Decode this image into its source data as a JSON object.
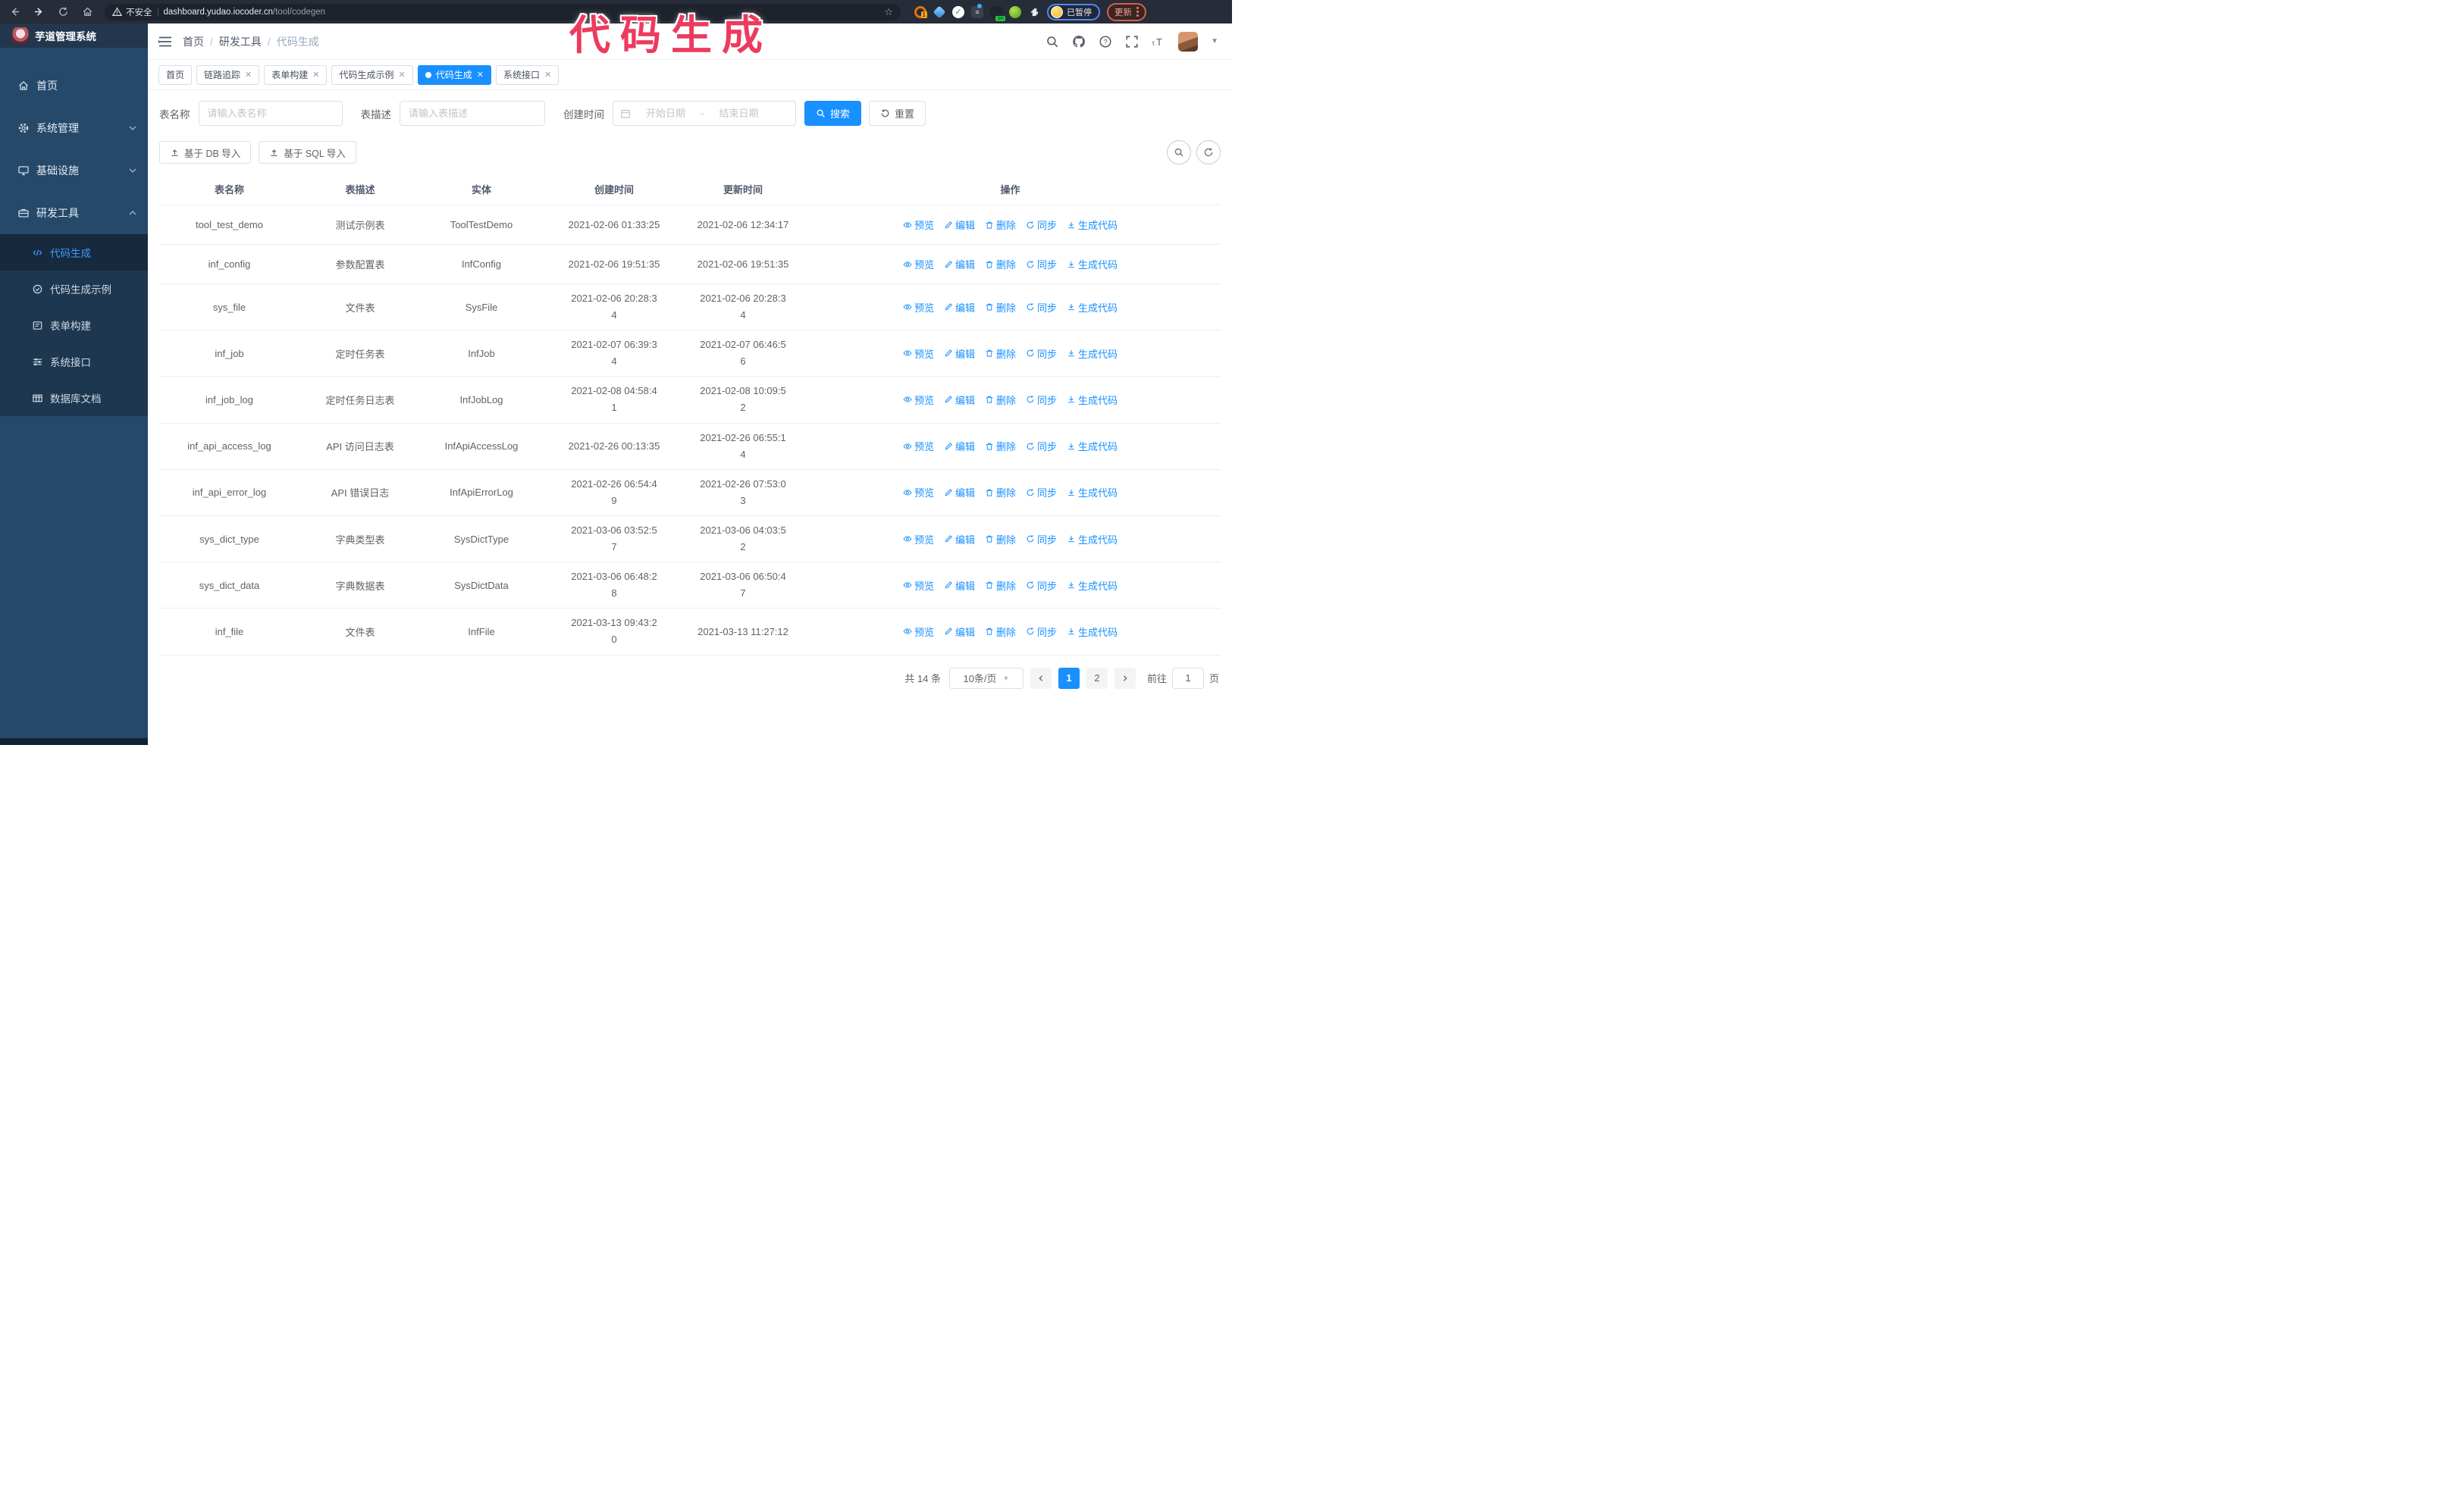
{
  "colors": {
    "accent": "#1890ff",
    "annotation": "#ed3a5f",
    "sidebar_bg": "#26496a",
    "submenu_bg": "#1d3750"
  },
  "annotation": {
    "text": "代码生成"
  },
  "browser": {
    "security_label": "不安全",
    "url_host": "dashboard.yudao.iocoder.cn",
    "url_path": "/tool/codegen",
    "ext_badge": "1",
    "ext_on_badge": "on",
    "paused_label": "已暂停",
    "update_label": "更新"
  },
  "sidebar": {
    "title": "芋道管理系统",
    "menu": [
      {
        "label": "首页",
        "icon": "home-icon"
      },
      {
        "label": "系统管理",
        "icon": "gear-icon",
        "chevron": "down"
      },
      {
        "label": "基础设施",
        "icon": "infrastructure-icon",
        "chevron": "down"
      },
      {
        "label": "研发工具",
        "icon": "tools-icon",
        "chevron": "up"
      }
    ],
    "submenu": [
      {
        "label": "代码生成",
        "icon": "code-icon",
        "active": true
      },
      {
        "label": "代码生成示例",
        "icon": "example-icon"
      },
      {
        "label": "表单构建",
        "icon": "form-icon"
      },
      {
        "label": "系统接口",
        "icon": "api-icon"
      },
      {
        "label": "数据库文档",
        "icon": "db-doc-icon"
      }
    ]
  },
  "header": {
    "breadcrumb": [
      "首页",
      "研发工具",
      "代码生成"
    ]
  },
  "tabs": [
    {
      "label": "首页",
      "closable": false
    },
    {
      "label": "链路追踪",
      "closable": true
    },
    {
      "label": "表单构建",
      "closable": true
    },
    {
      "label": "代码生成示例",
      "closable": true
    },
    {
      "label": "代码生成",
      "closable": true,
      "active": true
    },
    {
      "label": "系统接口",
      "closable": true
    }
  ],
  "filters": {
    "name_label": "表名称",
    "name_placeholder": "请输入表名称",
    "desc_label": "表描述",
    "desc_placeholder": "请输入表描述",
    "time_label": "创建时间",
    "start_placeholder": "开始日期",
    "range_separator": "-",
    "end_placeholder": "结束日期",
    "search_label": "搜索",
    "reset_label": "重置"
  },
  "toolbar": {
    "import_db_label": "基于 DB 导入",
    "import_sql_label": "基于 SQL 导入"
  },
  "table": {
    "columns": [
      "表名称",
      "表描述",
      "实体",
      "创建时间",
      "更新时间",
      "操作"
    ],
    "actions": [
      "预览",
      "编辑",
      "删除",
      "同步",
      "生成代码"
    ],
    "rows": [
      {
        "name": "tool_test_demo",
        "desc": "测试示例表",
        "entity": "ToolTestDemo",
        "created": "2021-02-06 01:33:25",
        "updated": "2021-02-06 12:34:17",
        "created_wrap": false,
        "updated_wrap": false
      },
      {
        "name": "inf_config",
        "desc": "参数配置表",
        "entity": "InfConfig",
        "created": "2021-02-06 19:51:35",
        "updated": "2021-02-06 19:51:35",
        "created_wrap": false,
        "updated_wrap": false
      },
      {
        "name": "sys_file",
        "desc": "文件表",
        "entity": "SysFile",
        "created": "2021-02-06 20:28:34",
        "updated": "2021-02-06 20:28:34",
        "created_wrap": true,
        "updated_wrap": true
      },
      {
        "name": "inf_job",
        "desc": "定时任务表",
        "entity": "InfJob",
        "created": "2021-02-07 06:39:34",
        "updated": "2021-02-07 06:46:56",
        "created_wrap": true,
        "updated_wrap": true
      },
      {
        "name": "inf_job_log",
        "desc": "定时任务日志表",
        "entity": "InfJobLog",
        "created": "2021-02-08 04:58:41",
        "updated": "2021-02-08 10:09:52",
        "created_wrap": true,
        "updated_wrap": true
      },
      {
        "name": "inf_api_access_log",
        "desc": "API 访问日志表",
        "entity": "InfApiAccessLog",
        "created": "2021-02-26 00:13:35",
        "updated": "2021-02-26 06:55:14",
        "created_wrap": false,
        "updated_wrap": true
      },
      {
        "name": "inf_api_error_log",
        "desc": "API 错误日志",
        "entity": "InfApiErrorLog",
        "created": "2021-02-26 06:54:49",
        "updated": "2021-02-26 07:53:03",
        "created_wrap": true,
        "updated_wrap": true
      },
      {
        "name": "sys_dict_type",
        "desc": "字典类型表",
        "entity": "SysDictType",
        "created": "2021-03-06 03:52:57",
        "updated": "2021-03-06 04:03:52",
        "created_wrap": true,
        "updated_wrap": true
      },
      {
        "name": "sys_dict_data",
        "desc": "字典数据表",
        "entity": "SysDictData",
        "created": "2021-03-06 06:48:28",
        "updated": "2021-03-06 06:50:47",
        "created_wrap": true,
        "updated_wrap": true
      },
      {
        "name": "inf_file",
        "desc": "文件表",
        "entity": "InfFile",
        "created": "2021-03-13 09:43:20",
        "updated": "2021-03-13 11:27:12",
        "created_wrap": true,
        "updated_wrap": false
      }
    ]
  },
  "pagination": {
    "total": "共 14 条",
    "page_size": "10条/页",
    "pages": [
      "1",
      "2"
    ],
    "active_page": "1",
    "goto_label": "前往",
    "goto_value": "1",
    "page_suffix": "页"
  }
}
